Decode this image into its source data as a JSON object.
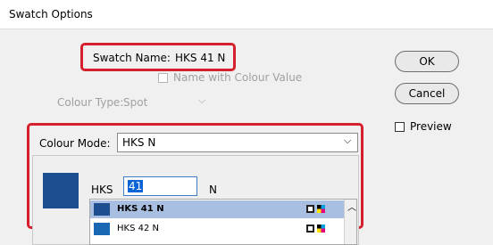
{
  "window": {
    "title": "Swatch Options"
  },
  "swatch_name": {
    "label": "Swatch Name:",
    "value": "HKS 41 N"
  },
  "name_with_colour_value": {
    "label": "Name with Colour Value"
  },
  "colour_type": {
    "label": "Colour Type:",
    "value": "Spot"
  },
  "colour_mode": {
    "label": "Colour Mode:",
    "value": "HKS N"
  },
  "hks": {
    "prefix": "HKS",
    "input_value": "41",
    "suffix": "N"
  },
  "buttons": {
    "ok": "OK",
    "cancel": "Cancel"
  },
  "preview": {
    "label": "Preview"
  },
  "swatch_list": [
    {
      "label": "HKS 41 N",
      "color": "#1d4e8f",
      "selected": true
    },
    {
      "label": "HKS 42 N",
      "color": "#1a67b3",
      "selected": false
    }
  ],
  "colors": {
    "highlight": "#d61f2c",
    "selection": "#a9bfe2",
    "preview_swatch": "#1d4e8f"
  }
}
